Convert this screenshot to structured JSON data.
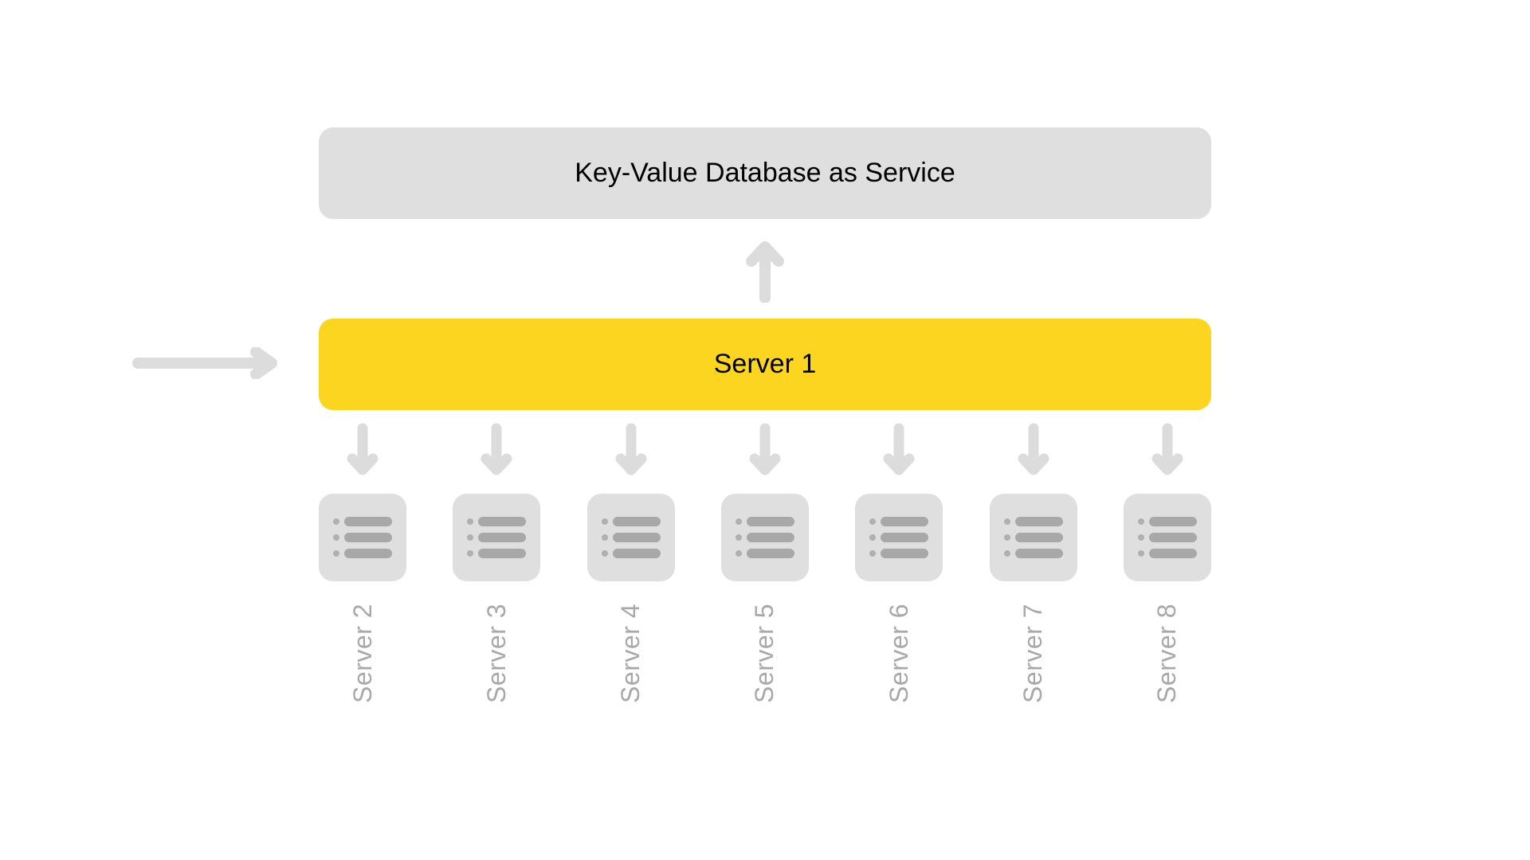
{
  "colors": {
    "grey_box": "#dfdfdf",
    "yellow_box": "#fcd520",
    "arrow": "#dcdcdc",
    "label_grey": "#a8a8a8",
    "icon_bar": "#a8a8a8",
    "icon_dot": "#b0b0b0"
  },
  "top_block": {
    "label": "Key-Value Database as Service"
  },
  "main_server": {
    "label": "Server 1"
  },
  "servers": [
    {
      "label": "Server 2"
    },
    {
      "label": "Server 3"
    },
    {
      "label": "Server 4"
    },
    {
      "label": "Server 5"
    },
    {
      "label": "Server 6"
    },
    {
      "label": "Server 7"
    },
    {
      "label": "Server 8"
    }
  ]
}
